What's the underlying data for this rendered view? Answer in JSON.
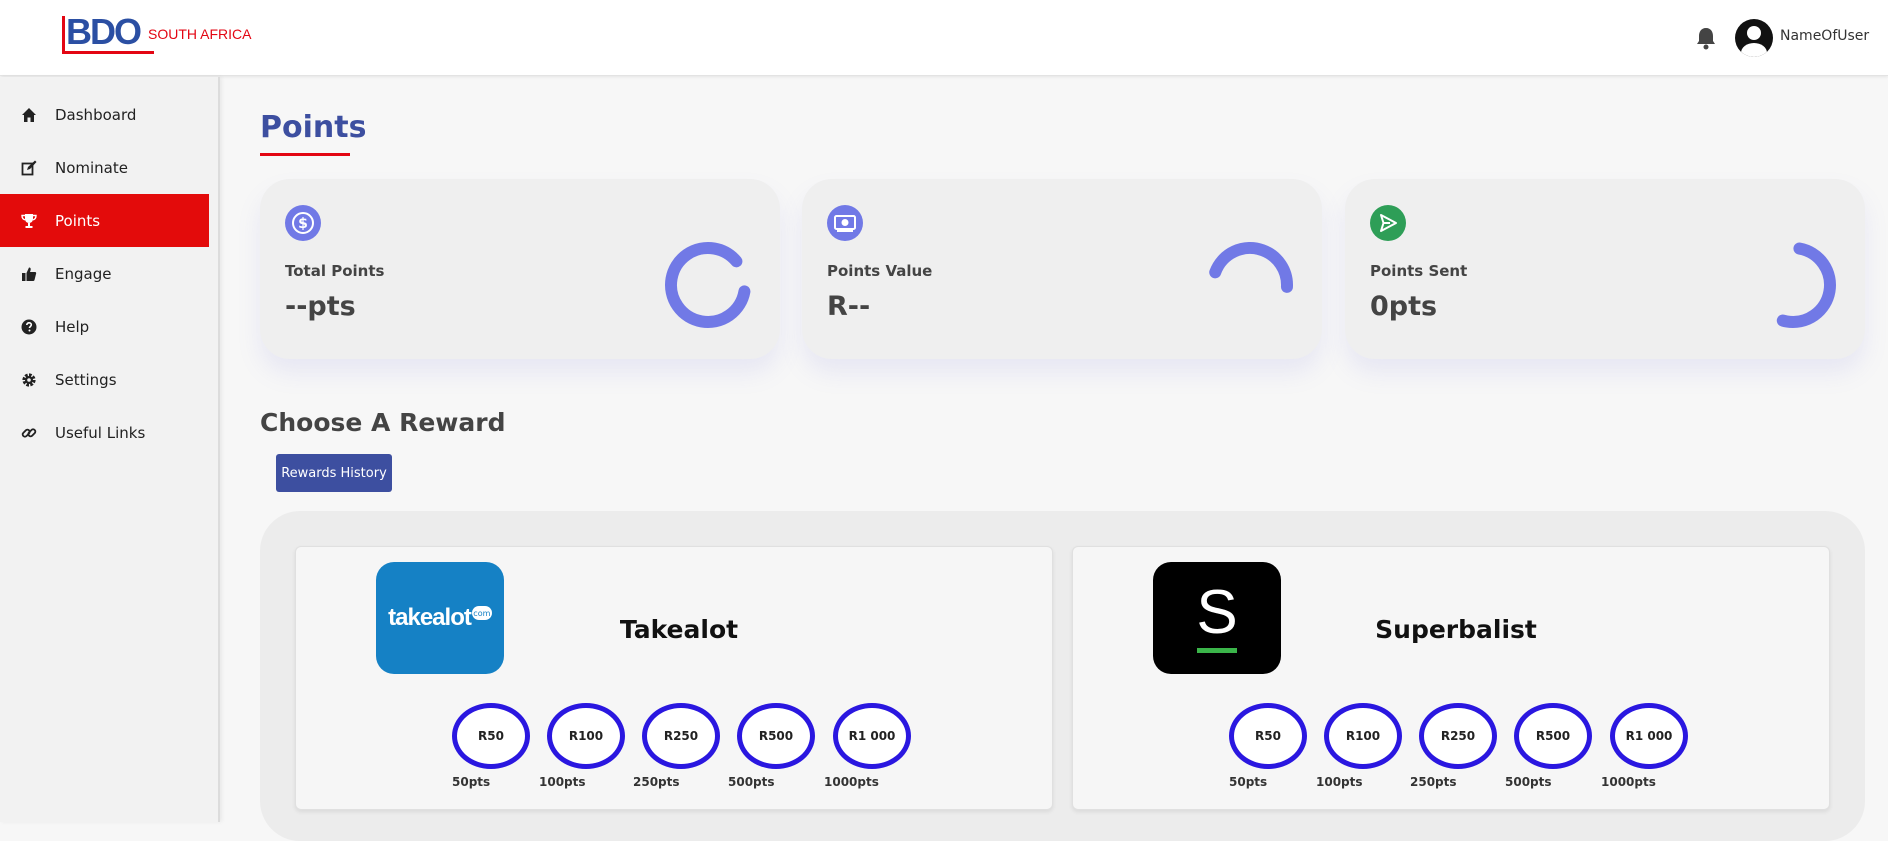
{
  "header": {
    "logo_text": "BDO",
    "logo_subtitle": "SOUTH AFRICA",
    "username": "NameOfUser"
  },
  "sidebar": {
    "items": [
      {
        "label": "Dashboard",
        "icon": "home-icon"
      },
      {
        "label": "Nominate",
        "icon": "edit-icon"
      },
      {
        "label": "Points",
        "icon": "trophy-icon",
        "active": true
      },
      {
        "label": "Engage",
        "icon": "thumbs-up-icon"
      },
      {
        "label": "Help",
        "icon": "help-circle-icon"
      },
      {
        "label": "Settings",
        "icon": "gear-icon"
      },
      {
        "label": "Useful Links",
        "icon": "link-icon"
      }
    ]
  },
  "page": {
    "title": "Points"
  },
  "stats": [
    {
      "label": "Total Points",
      "value": "--pts",
      "icon": "dollar-coin-icon",
      "icon_color": "#7179e6"
    },
    {
      "label": "Points Value",
      "value": "R--",
      "icon": "cash-icon",
      "icon_color": "#7179e6"
    },
    {
      "label": "Points Sent",
      "value": "0pts",
      "icon": "send-icon",
      "icon_color": "#2e9e57"
    }
  ],
  "rewards": {
    "section_title": "Choose A Reward",
    "history_button": "Rewards History",
    "brands": [
      {
        "name": "Takealot",
        "logo_text": "takealot",
        "logo_badge": "com",
        "options": [
          {
            "amount": "R50",
            "points": "50pts"
          },
          {
            "amount": "R100",
            "points": "100pts"
          },
          {
            "amount": "R250",
            "points": "250pts"
          },
          {
            "amount": "R500",
            "points": "500pts"
          },
          {
            "amount": "R1 000",
            "points": "1000pts"
          }
        ]
      },
      {
        "name": "Superbalist",
        "logo_text": "S",
        "options": [
          {
            "amount": "R50",
            "points": "50pts"
          },
          {
            "amount": "R100",
            "points": "100pts"
          },
          {
            "amount": "R250",
            "points": "250pts"
          },
          {
            "amount": "R500",
            "points": "500pts"
          },
          {
            "amount": "R1 000",
            "points": "1000pts"
          }
        ]
      }
    ]
  },
  "colors": {
    "brand_blue": "#3d4fa0",
    "brand_red": "#e30613",
    "active_nav": "#e30b0b",
    "ring": "#7179e6",
    "denom_ring": "#2a17e0",
    "takealot_blue": "#1581c5",
    "superbalist_black": "#000000"
  }
}
